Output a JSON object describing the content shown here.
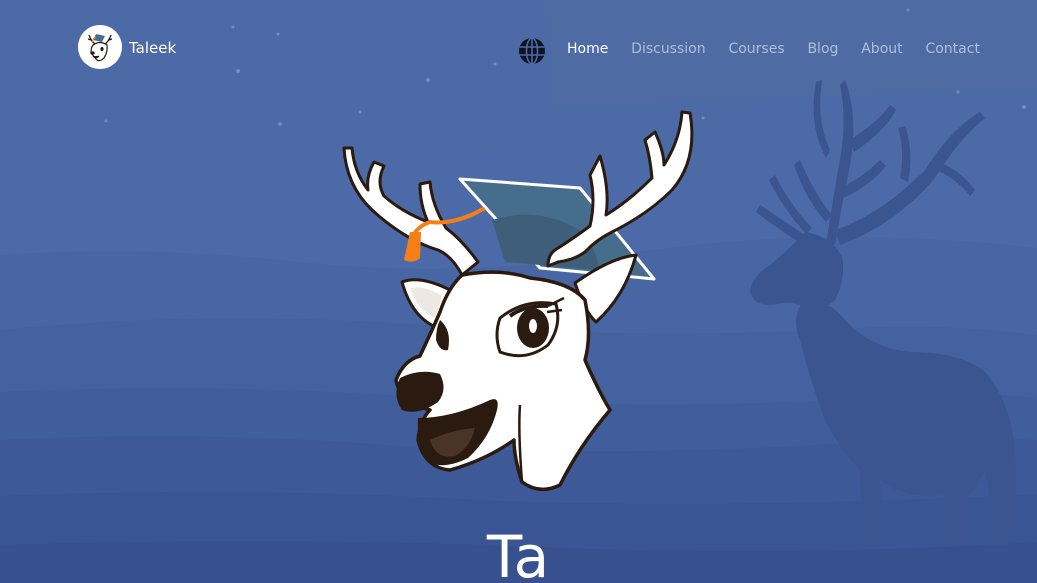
{
  "brand": {
    "name": "Taleek",
    "logo_icon": "deer-mascot-icon"
  },
  "nav": {
    "language_icon": "globe-icon",
    "links": [
      {
        "label": "Home",
        "active": true
      },
      {
        "label": "Discussion",
        "active": false
      },
      {
        "label": "Courses",
        "active": false
      },
      {
        "label": "Blog",
        "active": false
      },
      {
        "label": "About",
        "active": false
      },
      {
        "label": "Contact",
        "active": false
      }
    ]
  },
  "hero": {
    "mascot_icon": "deer-graduation-cap-icon",
    "background_icon": "deer-silhouette-icon",
    "title": "Ta"
  },
  "colors": {
    "sky": "#4c6aa6",
    "hill_light": "#4d6aa8",
    "hill_mid": "#4461a0",
    "hill_dark": "#3a5593",
    "deer_silhouette": "#3a5590",
    "text": "#ffffff",
    "nav_inactive": "rgba(255,255,255,0.55)",
    "tassel": "#f57f17",
    "cap": "#476d8c"
  }
}
